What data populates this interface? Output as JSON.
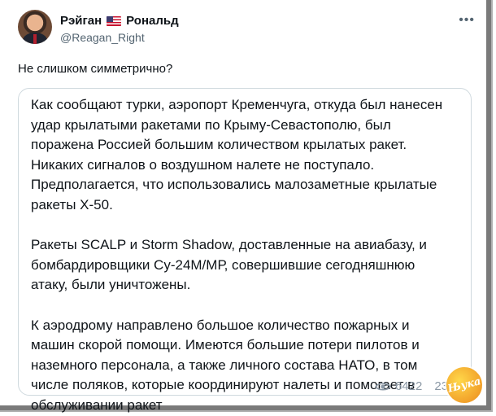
{
  "post": {
    "author_name_part1": "Рэйган",
    "author_name_part2": "Рональд",
    "author_flag_icon": "us-flag-icon",
    "author_handle": "@Reagan_Right",
    "text": "Не слишком симметрично?"
  },
  "quoted": {
    "paragraph1": "Как сообщают турки, аэропорт Кременчуга, откуда был нанесен удар крылатыми ракетами по Крыму-Севастополю, был поражена Россией большим количеством крылатых ракет. Никаких сигналов о воздушном налете не поступало. Предполагается, что использовались малозаметные крылатые ракеты Х-50.",
    "paragraph2": "Ракеты SCALP и Storm Shadow, доставленные на авиабазу, и бомбардировщики Су-24М/МР, совершившие сегодняшнюю атаку, были уничтожены.",
    "paragraph3": "К аэродрому направлено большое количество пожарных и машин скорой помощи. Имеются большие потери пилотов и наземного персонала, а также личного состава НАТО, в том числе поляков, которые координируют налеты и помогает в обслуживании ракет"
  },
  "meta": {
    "views": "6422",
    "second_count": "23"
  },
  "watermark": {
    "text": "Њука"
  },
  "colors": {
    "text": "#0f1419",
    "secondary": "#536471",
    "border": "#cfd9de",
    "frame": "#7a7a7a",
    "watermark": "#f2a12a"
  }
}
